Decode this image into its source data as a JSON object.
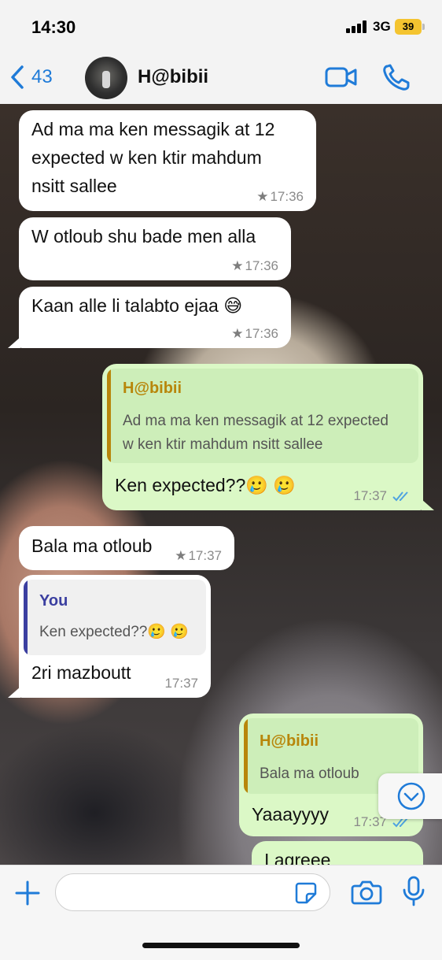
{
  "status_bar": {
    "time": "14:30",
    "network": "3G",
    "battery": "39"
  },
  "header": {
    "back_count": "43",
    "contact_name": "H@bibii"
  },
  "messages": [
    {
      "direction": "incoming",
      "text_lines": [
        "Ad ma ma ken messagik at 12",
        "expected w ken ktir mahdum",
        "nsitt sallee"
      ],
      "time": "17:36",
      "starred": true
    },
    {
      "direction": "incoming",
      "text": "W otloub shu bade men alla",
      "time": "17:36",
      "starred": true
    },
    {
      "direction": "incoming",
      "text": "Kaan alle li talabto ejaa 😅",
      "time": "17:36",
      "starred": true
    },
    {
      "direction": "outgoing",
      "quote": {
        "author": "H@bibii",
        "text_lines": [
          "Ad ma ma ken messagik at 12 expected",
          "w ken ktir mahdum nsitt sallee"
        ]
      },
      "text": "Ken expected??🥲 🥲",
      "time": "17:37",
      "status": "read"
    },
    {
      "direction": "incoming",
      "text": "Bala ma otloub",
      "time": "17:37",
      "starred": true
    },
    {
      "direction": "incoming",
      "quote": {
        "author": "You",
        "text": "Ken expected??🥲 🥲"
      },
      "text": "2ri mazboutt",
      "time": "17:37",
      "starred": false
    },
    {
      "direction": "outgoing",
      "quote": {
        "author": "H@bibii",
        "text": "Bala ma otloub"
      },
      "text": "Yaaayyyy",
      "time": "17:37",
      "status": "read"
    },
    {
      "direction": "outgoing",
      "text": "I agreee",
      "time": "",
      "partial": true
    }
  ],
  "colors": {
    "accent_blue": "#1f7bd8",
    "outgoing_bubble": "#dbf8c6",
    "incoming_bubble": "#ffffff",
    "quote_author_habibii": "#b8860b",
    "quote_author_you": "#3b3fa0",
    "read_tick": "#4fa3e0",
    "battery": "#f4c430"
  },
  "icons": {
    "back": "chevron-left-icon",
    "video": "video-camera-icon",
    "call": "phone-icon",
    "star": "star-icon",
    "read": "double-check-icon",
    "scroll_down": "chevron-down-circle-icon",
    "attach": "plus-icon",
    "sticker": "sticker-icon",
    "camera": "camera-icon",
    "mic": "microphone-icon"
  },
  "input": {
    "value": "",
    "placeholder": ""
  }
}
